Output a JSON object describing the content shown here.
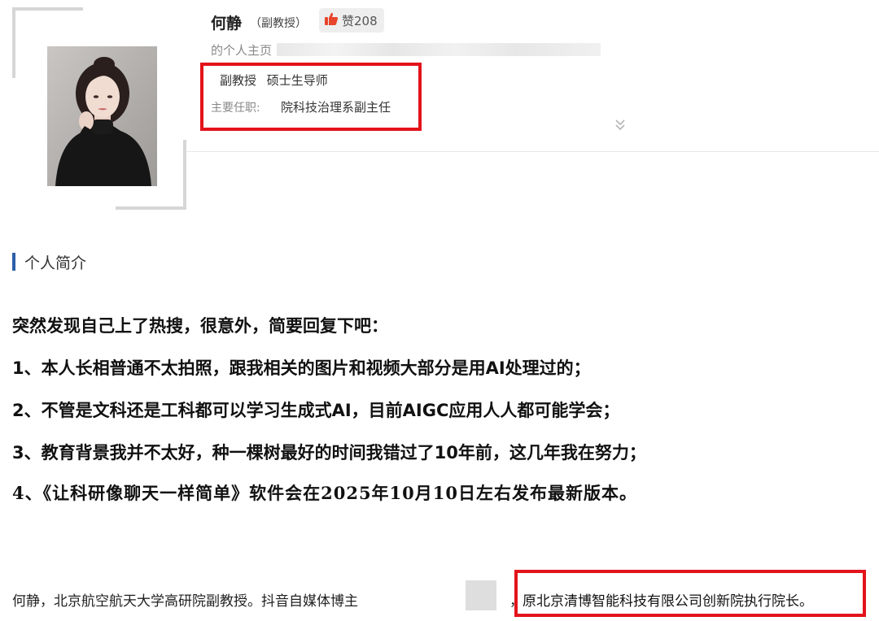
{
  "profile": {
    "name": "何静",
    "title_paren": "（副教授）",
    "likes_label": "赞208",
    "homepage_label": "的个人主页",
    "positions": "副教授 硕士生导师",
    "duty_label": "主要任职:",
    "duty_value": "院科技治理系副主任"
  },
  "section": {
    "title": "个人简介"
  },
  "intro": {
    "lines": [
      "突然发现自己上了热搜，很意外，简要回复下吧：",
      "1、本人长相普通不太拍照，跟我相关的图片和视频大部分是用AI处理过的；",
      "2、不管是文科还是工科都可以学习生成式AI，目前AIGC应用人人都可能学会；",
      "3、教育背景我并不太好，种一棵树最好的时间我错过了10年前，这几年我在努力；",
      "4、《让科研像聊天一样简单》软件会在2025年10月10日左右发布最新版本。"
    ]
  },
  "bio": {
    "text": "何静，北京航空航天大学高研院副教授。抖音自媒体博主",
    "separator": "，",
    "highlight": "原北京清博智能科技有限公司创新院执行院长。"
  },
  "colors": {
    "highlight_border": "#e3131b",
    "thumb": "#e8452c",
    "section_accent": "#2d5fa8"
  }
}
